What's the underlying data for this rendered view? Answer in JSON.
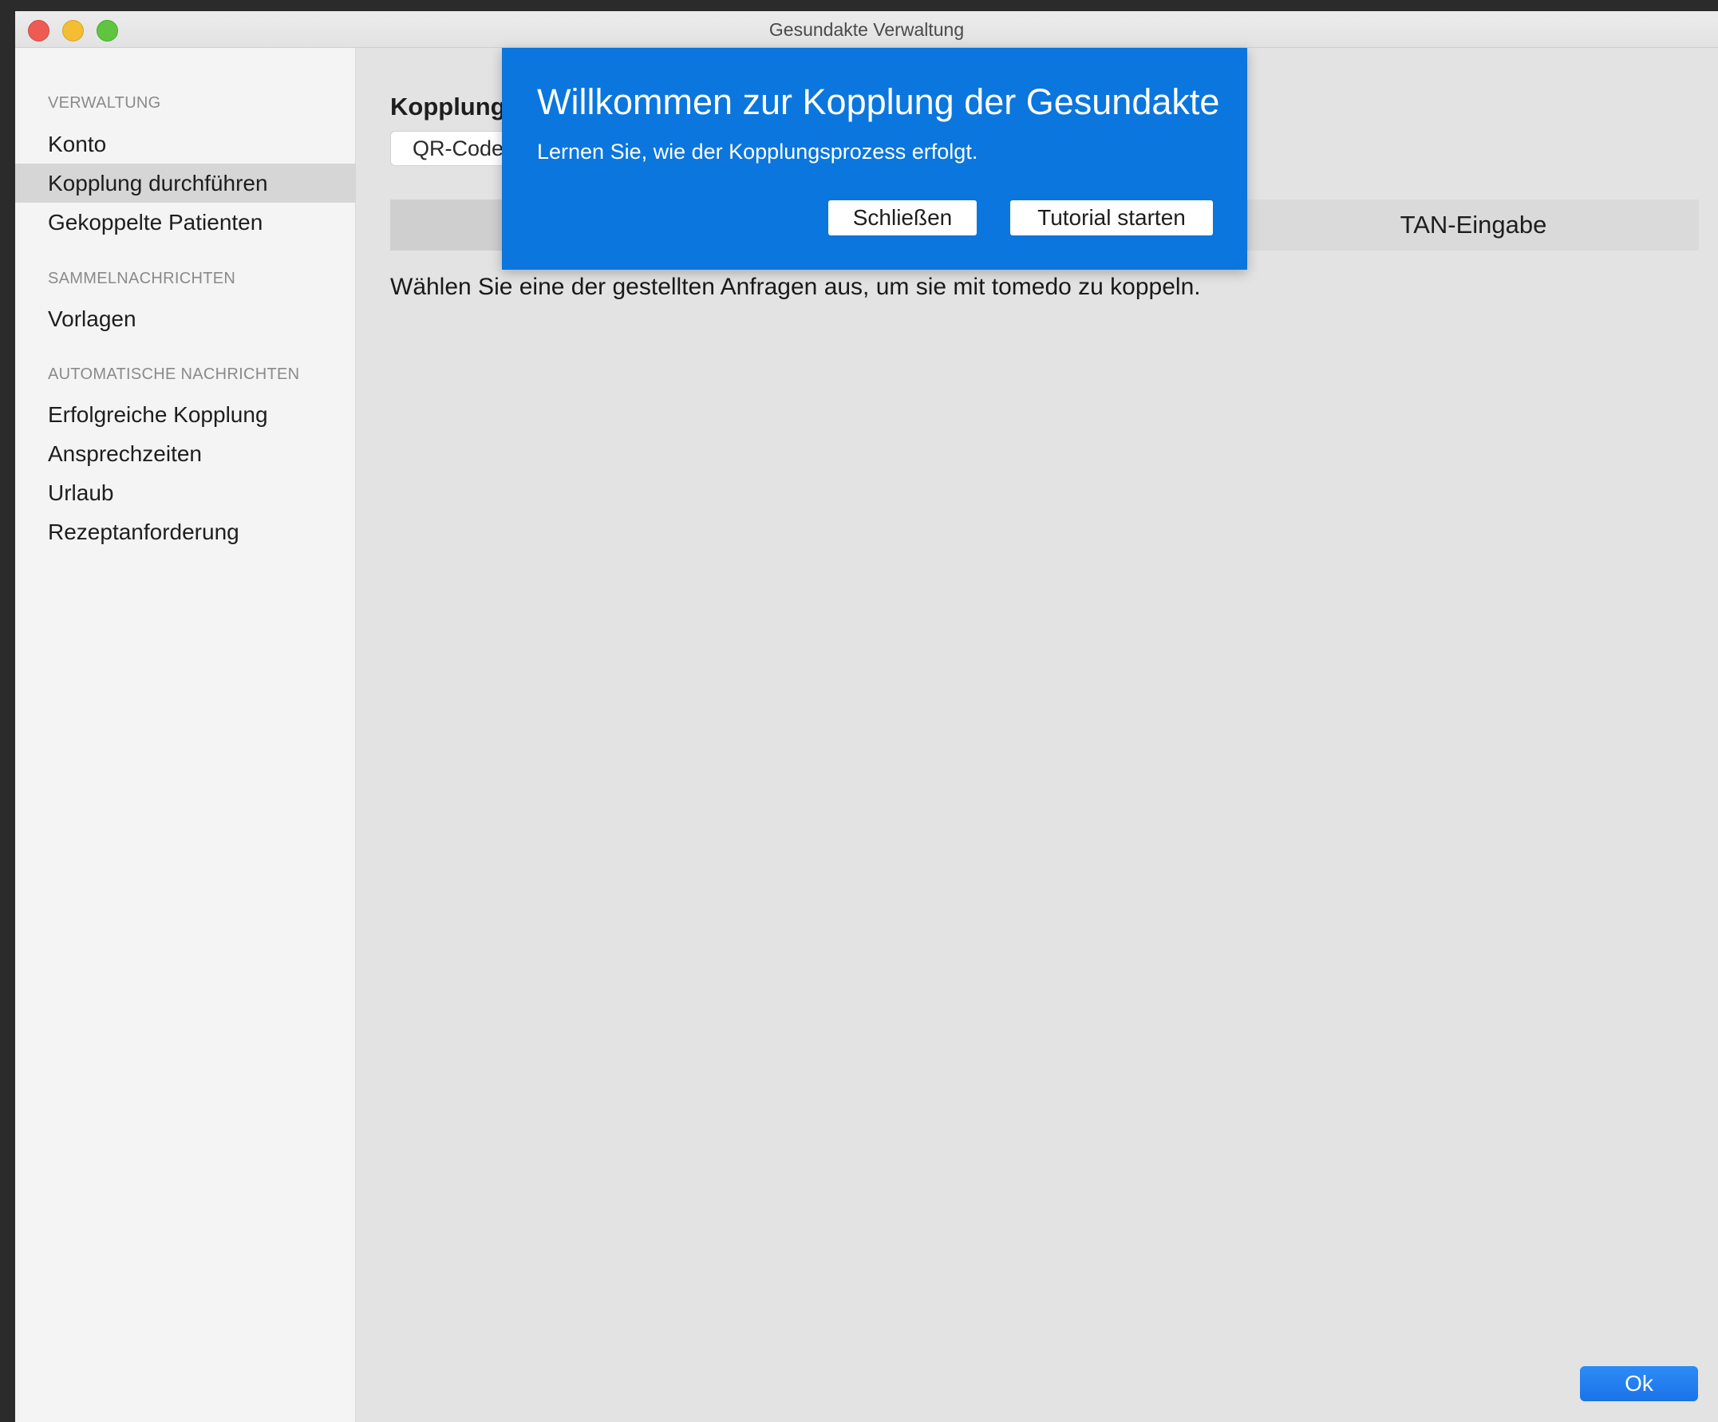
{
  "window": {
    "title": "Gesundakte Verwaltung"
  },
  "sidebar": {
    "sections": [
      {
        "label": "VERWALTUNG",
        "items": [
          {
            "label": "Konto",
            "selected": false
          },
          {
            "label": "Kopplung durchführen",
            "selected": true
          },
          {
            "label": "Gekoppelte Patienten",
            "selected": false
          }
        ]
      },
      {
        "label": "SAMMELNACHRICHTEN",
        "items": [
          {
            "label": "Vorlagen",
            "selected": false
          }
        ]
      },
      {
        "label": "AUTOMATISCHE NACHRICHTEN",
        "items": [
          {
            "label": "Erfolgreiche Kopplung",
            "selected": false
          },
          {
            "label": "Ansprechzeiten",
            "selected": false
          },
          {
            "label": "Urlaub",
            "selected": false
          },
          {
            "label": "Rezeptanforderung",
            "selected": false
          }
        ]
      }
    ]
  },
  "main": {
    "heading": "Kopplung",
    "qr_button_label": "QR-Code",
    "tab_tan_label": "TAN-Eingabe",
    "instruction": "Wählen Sie eine der gestellten Anfragen aus, um sie mit tomedo zu koppeln.",
    "ok_label": "Ok"
  },
  "popover": {
    "title": "Willkommen zur Kopplung der Gesundakte",
    "subtitle": "Lernen Sie, wie der Kopplungsprozess erfolgt.",
    "close_label": "Schließen",
    "tutorial_label": "Tutorial starten"
  },
  "colors": {
    "popover_background": "#0b76dd",
    "accent_button": "#1a73e8",
    "selected_item": "#d6d6d6"
  }
}
